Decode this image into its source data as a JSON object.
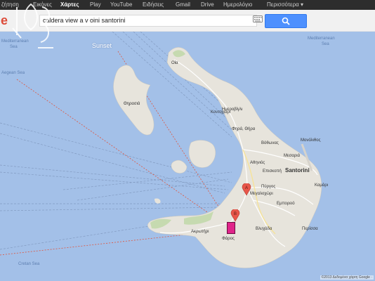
{
  "topbar": {
    "items": [
      {
        "label": "ζήτηση",
        "active": false
      },
      {
        "label": "Εικόνες",
        "active": false
      },
      {
        "label": "Χάρτες",
        "active": true
      },
      {
        "label": "Play",
        "active": false
      },
      {
        "label": "YouTube",
        "active": false
      },
      {
        "label": "Ειδήσεις",
        "active": false
      },
      {
        "label": "Gmail",
        "active": false
      },
      {
        "label": "Drive",
        "active": false
      },
      {
        "label": "Ημερολόγιο",
        "active": false
      },
      {
        "label": "Περισσότερα ▾",
        "active": false
      }
    ]
  },
  "search": {
    "logo_fragment": "le",
    "query": "caldera view a v oini santorini"
  },
  "map": {
    "sunset_label": "Sunset",
    "labels": {
      "sea_tl": "Mediterranean",
      "sea_tl2": "Sea",
      "sea_left": "Aegean Sea",
      "sea_tr": "Mediterranean",
      "sea_tr2": "Sea",
      "cretan_sea": "Cretan Sea",
      "oia": "Οία",
      "fira_area": "Ημεροβίγλι",
      "fira": "Φηρά, Θήρα",
      "thirasia": "Θηρασιά",
      "messaria": "Μεσαριά",
      "santorini": "Santorini",
      "pyrgos": "Πύργος",
      "megalochori": "Μεγαλοχώρι",
      "akrotiri": "Ακρωτήρι",
      "kamari": "Καμάρι",
      "emporio": "Εμπορειό",
      "perissa": "Περίσσα",
      "monolithos": "Μονόλιθος",
      "episkopi": "Επισκοπή",
      "imerovigli": "Ημεροβίγλι",
      "vlychada": "Βλυχάδα",
      "faros": "Φάρος",
      "vothonas": "Βόθωνας",
      "kontochori": "Κοντοχώρι",
      "athinios": "Αθηνιός",
      "copyright": "©2013 Δεδομένα χάρτη Google ·"
    },
    "markers": [
      {
        "letter": "A",
        "color": "#e8564a"
      },
      {
        "letter": "B",
        "color": "#e8564a"
      }
    ],
    "colors": {
      "sea": "#a3c0e8",
      "land": "#e7e4dc",
      "green": "#c6dab0",
      "route": "#e74a2e"
    }
  }
}
